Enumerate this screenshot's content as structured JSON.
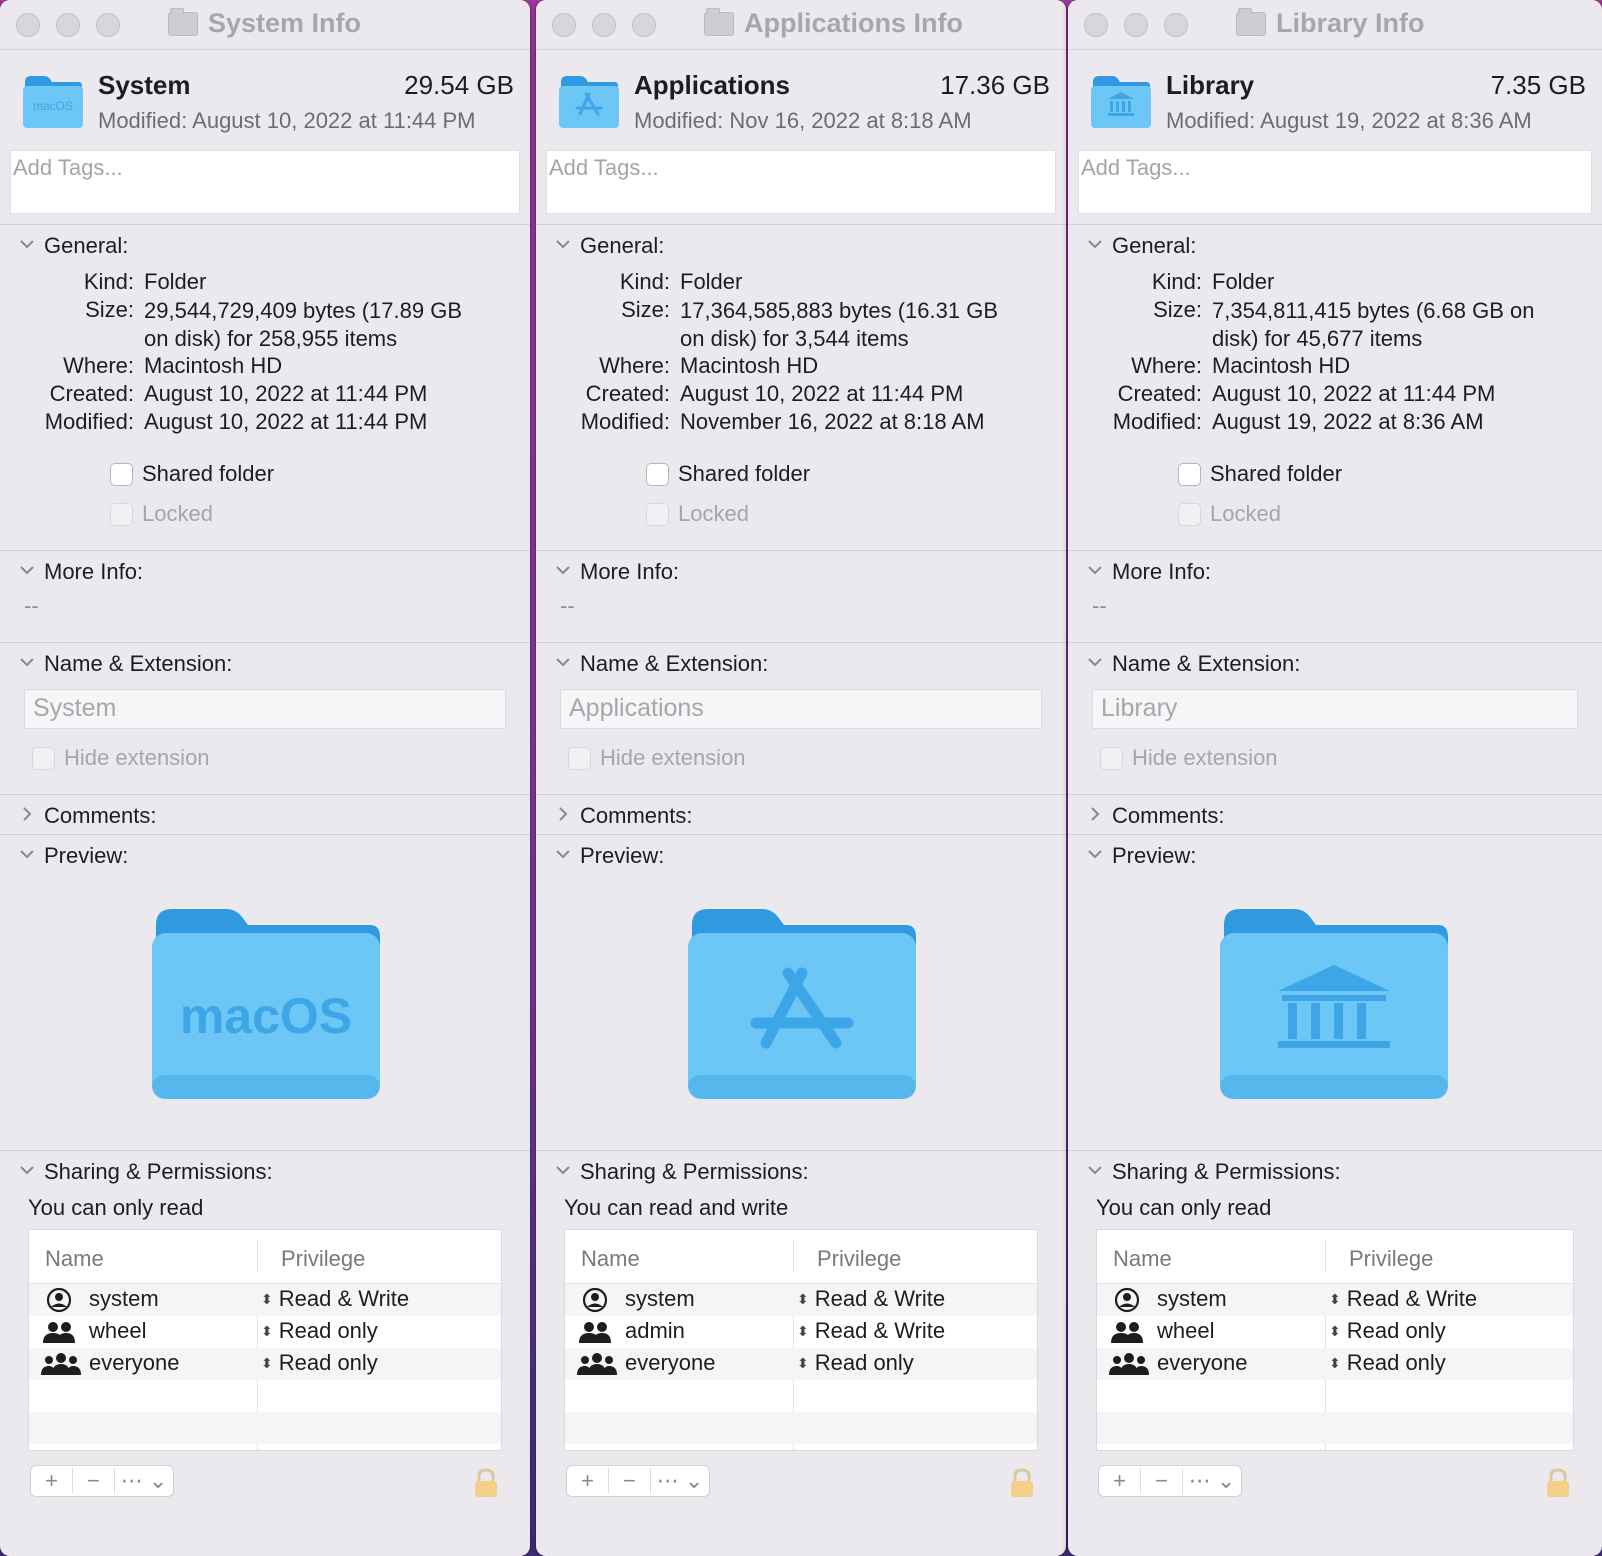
{
  "windows": [
    {
      "title": "System Info",
      "name": "System",
      "size": "29.54 GB",
      "modified_header": "Modified:  August 10, 2022 at 11:44 PM",
      "tags_placeholder": "Add Tags...",
      "folder_badge": "macOS",
      "general": {
        "label": "General:",
        "kind_label": "Kind:",
        "kind": "Folder",
        "size_label": "Size:",
        "size_line1": "29,544,729,409 bytes (17.89 GB",
        "size_line2": "on disk) for 258,955 items",
        "where_label": "Where:",
        "where": "Macintosh HD",
        "created_label": "Created:",
        "created": "August 10, 2022 at 11:44 PM",
        "modified_label": "Modified:",
        "modified": "August 10, 2022 at 11:44 PM",
        "shared_folder": "Shared folder",
        "locked": "Locked"
      },
      "more_info": {
        "label": "More Info:",
        "value": "--"
      },
      "name_ext": {
        "label": "Name & Extension:",
        "field": "System",
        "hide_ext": "Hide extension"
      },
      "comments": "Comments:",
      "preview": "Preview:",
      "preview_text": "macOS",
      "sharing": {
        "label": "Sharing & Permissions:",
        "status": "You can only read",
        "col_name": "Name",
        "col_priv": "Privilege",
        "rows": [
          {
            "icon": "user-icon",
            "name": "system",
            "priv": "Read & Write"
          },
          {
            "icon": "group-icon",
            "name": "wheel",
            "priv": "Read only"
          },
          {
            "icon": "everyone-icon",
            "name": "everyone",
            "priv": "Read only"
          }
        ]
      },
      "buttons": {
        "add": "+",
        "remove": "−",
        "action": "⋯ ⌄"
      }
    },
    {
      "title": "Applications Info",
      "name": "Applications",
      "size": "17.36 GB",
      "modified_header": "Modified:  Nov 16, 2022 at 8:18 AM",
      "tags_placeholder": "Add Tags...",
      "general": {
        "label": "General:",
        "kind_label": "Kind:",
        "kind": "Folder",
        "size_label": "Size:",
        "size_line1": "17,364,585,883 bytes (16.31 GB",
        "size_line2": "on disk) for 3,544 items",
        "where_label": "Where:",
        "where": "Macintosh HD",
        "created_label": "Created:",
        "created": "August 10, 2022 at 11:44 PM",
        "modified_label": "Modified:",
        "modified": "November 16, 2022 at 8:18 AM",
        "shared_folder": "Shared folder",
        "locked": "Locked"
      },
      "more_info": {
        "label": "More Info:",
        "value": "--"
      },
      "name_ext": {
        "label": "Name & Extension:",
        "field": "Applications",
        "hide_ext": "Hide extension"
      },
      "comments": "Comments:",
      "preview": "Preview:",
      "sharing": {
        "label": "Sharing & Permissions:",
        "status": "You can read and write",
        "col_name": "Name",
        "col_priv": "Privilege",
        "rows": [
          {
            "icon": "user-icon",
            "name": "system",
            "priv": "Read & Write"
          },
          {
            "icon": "group-icon",
            "name": "admin",
            "priv": "Read & Write"
          },
          {
            "icon": "everyone-icon",
            "name": "everyone",
            "priv": "Read only"
          }
        ]
      },
      "buttons": {
        "add": "+",
        "remove": "−",
        "action": "⋯ ⌄"
      }
    },
    {
      "title": "Library Info",
      "name": "Library",
      "size": "7.35 GB",
      "modified_header": "Modified:  August 19, 2022 at 8:36 AM",
      "tags_placeholder": "Add Tags...",
      "general": {
        "label": "General:",
        "kind_label": "Kind:",
        "kind": "Folder",
        "size_label": "Size:",
        "size_line1": "7,354,811,415 bytes (6.68 GB on",
        "size_line2": "disk) for 45,677 items",
        "where_label": "Where:",
        "where": "Macintosh HD",
        "created_label": "Created:",
        "created": "August 10, 2022 at 11:44 PM",
        "modified_label": "Modified:",
        "modified": "August 19, 2022 at 8:36 AM",
        "shared_folder": "Shared folder",
        "locked": "Locked"
      },
      "more_info": {
        "label": "More Info:",
        "value": "--"
      },
      "name_ext": {
        "label": "Name & Extension:",
        "field": "Library",
        "hide_ext": "Hide extension"
      },
      "comments": "Comments:",
      "preview": "Preview:",
      "sharing": {
        "label": "Sharing & Permissions:",
        "status": "You can only read",
        "col_name": "Name",
        "col_priv": "Privilege",
        "rows": [
          {
            "icon": "user-icon",
            "name": "system",
            "priv": "Read & Write"
          },
          {
            "icon": "group-icon",
            "name": "wheel",
            "priv": "Read only"
          },
          {
            "icon": "everyone-icon",
            "name": "everyone",
            "priv": "Read only"
          }
        ]
      },
      "buttons": {
        "add": "+",
        "remove": "−",
        "action": "⋯ ⌄"
      }
    }
  ],
  "colors": {
    "folder_light": "#6cc6f6",
    "folder_dark": "#2f9ae0",
    "folder_emboss": "#3da6e6",
    "window_bg": "#ece9ee"
  }
}
